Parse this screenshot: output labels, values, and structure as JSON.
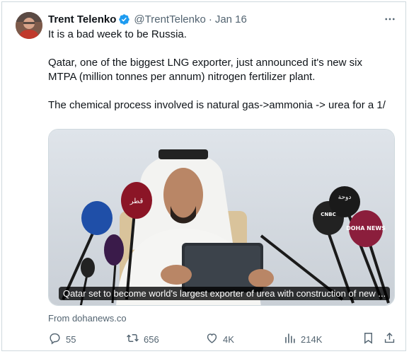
{
  "tweet": {
    "author_name": "Trent Telenko",
    "handle": "@TrentTelenko",
    "separator": "·",
    "date": "Jan 16",
    "text_lines": [
      "It is a bad week to be Russia.",
      "Qatar, one of the biggest LNG exporter, just announced it's new six MTPA (million tonnes per annum) nitrogen fertilizer plant.",
      "The chemical process involved is natural gas->ammonia -> urea for a 1/"
    ]
  },
  "media": {
    "caption": "Qatar set to become world's largest exporter of urea with construction of new ...",
    "source": "From dohanews.co",
    "mic_labels": [
      "قطر",
      "دوحة",
      "DOHA NEWS",
      "CNBC"
    ]
  },
  "actions": {
    "replies": "55",
    "reposts": "656",
    "likes": "4K",
    "views": "214K"
  },
  "colors": {
    "verified": "#1d9bf0",
    "muted": "#536471",
    "text": "#0f1419"
  },
  "icons": [
    "verified-badge-icon",
    "more-icon",
    "reply-icon",
    "repost-icon",
    "like-icon",
    "views-icon",
    "bookmark-icon",
    "share-icon"
  ]
}
